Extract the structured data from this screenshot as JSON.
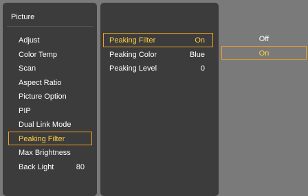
{
  "main_menu": {
    "title": "Picture",
    "items": [
      {
        "label": "Adjust",
        "value": ""
      },
      {
        "label": "Color Temp",
        "value": ""
      },
      {
        "label": "Scan",
        "value": ""
      },
      {
        "label": "Aspect Ratio",
        "value": ""
      },
      {
        "label": "Picture Option",
        "value": ""
      },
      {
        "label": "PIP",
        "value": ""
      },
      {
        "label": "Dual Link Mode",
        "value": ""
      },
      {
        "label": "Peaking Filter",
        "value": ""
      },
      {
        "label": "Max Brightness",
        "value": ""
      },
      {
        "label": "Back Light",
        "value": "80"
      }
    ],
    "selected_index": 7
  },
  "sub_menu": {
    "items": [
      {
        "label": "Peaking Filter",
        "value": "On"
      },
      {
        "label": "Peaking Color",
        "value": "Blue"
      },
      {
        "label": "Peaking Level",
        "value": "0"
      }
    ],
    "selected_index": 0
  },
  "options": {
    "items": [
      "Off",
      "On"
    ],
    "selected_index": 1
  },
  "colors": {
    "panel_bg": "#3c3c3c",
    "page_bg": "#7a7a7a",
    "highlight_border": "#f0a020",
    "highlight_text": "#ffd040"
  }
}
